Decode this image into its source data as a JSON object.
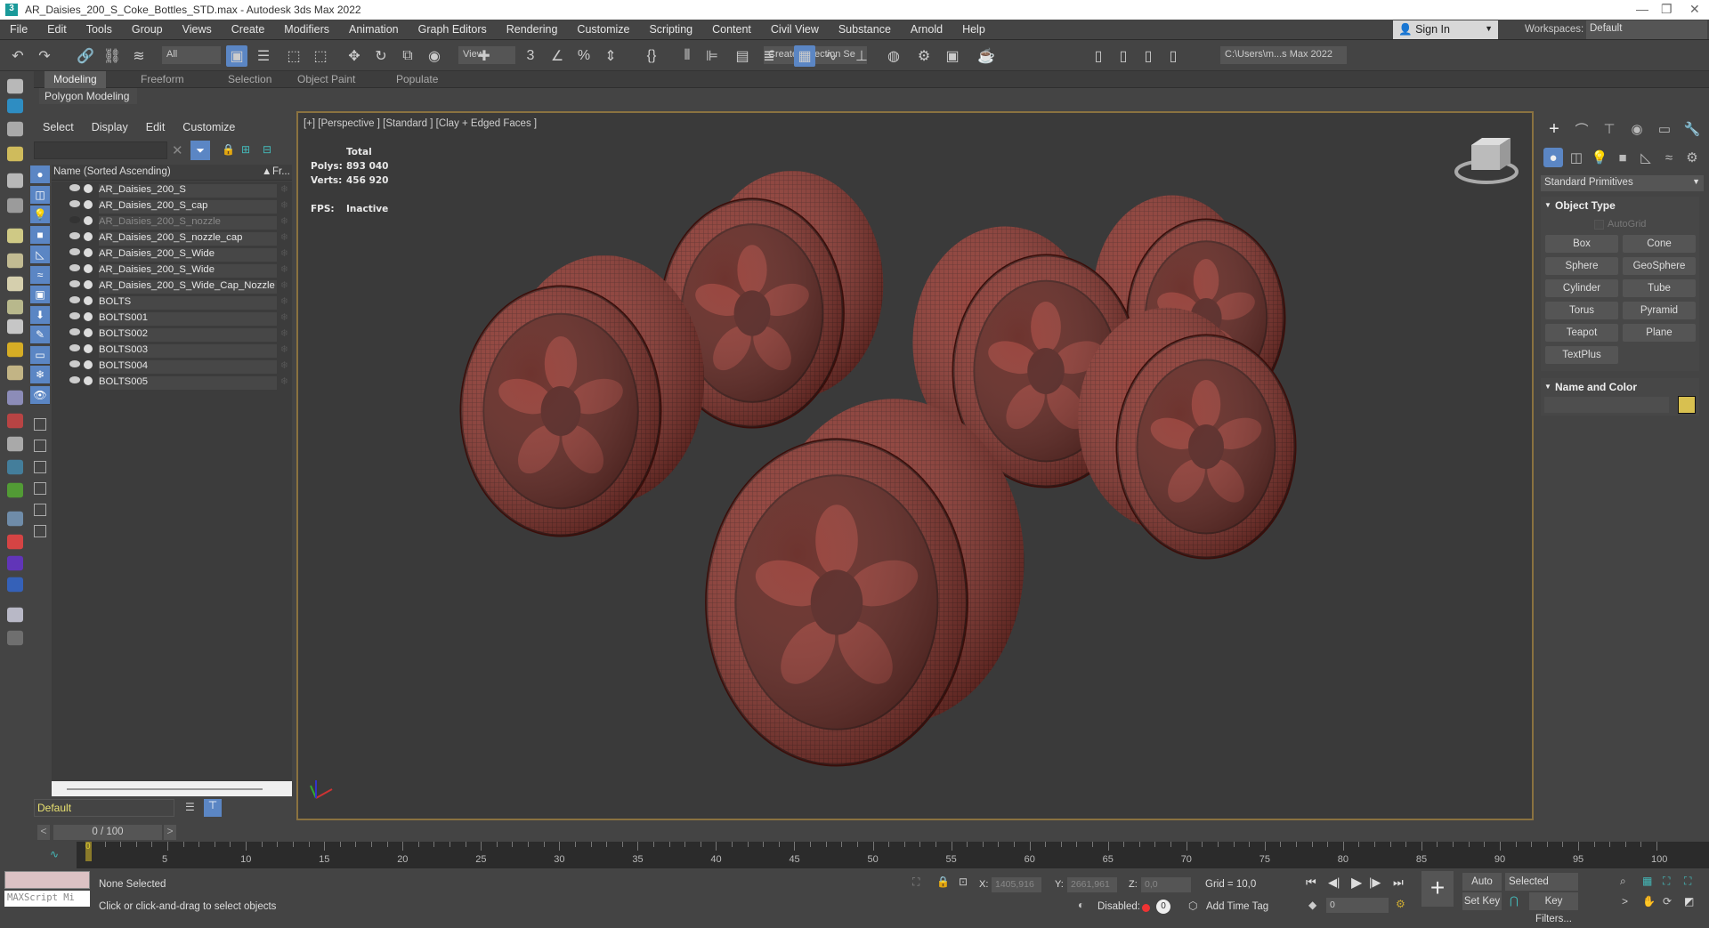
{
  "window": {
    "title": "AR_Daisies_200_S_Coke_Bottles_STD.max - Autodesk 3ds Max 2022",
    "app_icon": "3",
    "controls": [
      "—",
      "❐",
      "✕"
    ]
  },
  "menu": [
    "File",
    "Edit",
    "Tools",
    "Group",
    "Views",
    "Create",
    "Modifiers",
    "Animation",
    "Graph Editors",
    "Rendering",
    "Customize",
    "Scripting",
    "Content",
    "Civil View",
    "Substance",
    "Arnold",
    "Help"
  ],
  "account": {
    "sign_in": "Sign In",
    "workspaces_label": "Workspaces:",
    "workspace": "Default"
  },
  "toolbar": {
    "selection_filter": "All",
    "ref_coord": "View",
    "named_selection": "Create Selection Se",
    "project_path": "C:\\Users\\m...s Max 2022",
    "icons": [
      "undo-icon",
      "redo-icon",
      "link-icon",
      "unlink-icon",
      "bind-space-warp-icon",
      "select-object-icon",
      "select-by-name-icon",
      "rect-selection-icon",
      "window-crossing-icon",
      "move-icon",
      "rotate-icon",
      "scale-icon",
      "placement-icon",
      "pivot-icon",
      "snap-icon",
      "angle-snap-icon",
      "percent-snap-icon",
      "spinner-snap-icon",
      "edit-named-sets-icon",
      "mirror-icon",
      "align-icon",
      "scene-explorer-icon",
      "layer-explorer-icon",
      "ribbon-toggle-icon",
      "curve-editor-icon",
      "schematic-icon",
      "material-editor-icon",
      "render-setup-icon",
      "rendered-frame-icon",
      "render-icon",
      "project-icon",
      "open-project-icon",
      "new-project-icon",
      "project-folder-icon"
    ]
  },
  "ribbon": {
    "tabs": [
      "Modeling",
      "Freeform",
      "Selection",
      "Object Paint",
      "Populate"
    ],
    "active": "Modeling",
    "panel": "Polygon Modeling"
  },
  "scene_explorer": {
    "menu": [
      "Select",
      "Display",
      "Edit",
      "Customize"
    ],
    "search_value": "",
    "column_name": "Name (Sorted Ascending)",
    "column_frozen": "Fr...",
    "items": [
      {
        "name": "AR_Daisies_200_S",
        "hidden": false
      },
      {
        "name": "AR_Daisies_200_S_cap",
        "hidden": false
      },
      {
        "name": "AR_Daisies_200_S_nozzle",
        "hidden": true
      },
      {
        "name": "AR_Daisies_200_S_nozzle_cap",
        "hidden": false
      },
      {
        "name": "AR_Daisies_200_S_Wide",
        "hidden": false
      },
      {
        "name": "AR_Daisies_200_S_Wide",
        "hidden": false
      },
      {
        "name": "AR_Daisies_200_S_Wide_Cap_Nozzle",
        "hidden": false
      },
      {
        "name": "BOLTS",
        "hidden": false
      },
      {
        "name": "BOLTS001",
        "hidden": false
      },
      {
        "name": "BOLTS002",
        "hidden": false
      },
      {
        "name": "BOLTS003",
        "hidden": false
      },
      {
        "name": "BOLTS004",
        "hidden": false
      },
      {
        "name": "BOLTS005",
        "hidden": false
      }
    ],
    "layer": "Default"
  },
  "viewport": {
    "label": "[+] [Perspective ] [Standard ] [Clay + Edged Faces ]",
    "stats_header": "Total",
    "polys_label": "Polys:",
    "polys": "893 040",
    "verts_label": "Verts:",
    "verts": "456 920",
    "fps_label": "FPS:",
    "fps": "Inactive",
    "object_color": "#7a2620"
  },
  "command_panel": {
    "category": "Standard Primitives",
    "object_type": "Object Type",
    "autogrid": "AutoGrid",
    "buttons": [
      "Box",
      "Cone",
      "Sphere",
      "GeoSphere",
      "Cylinder",
      "Tube",
      "Torus",
      "Pyramid",
      "Teapot",
      "Plane",
      "TextPlus"
    ],
    "name_and_color": "Name and Color",
    "name_value": "",
    "swatch_color": "#d8c050"
  },
  "timeline": {
    "slider": "0 / 100",
    "start": 0,
    "end": 100,
    "label_step": 5
  },
  "status": {
    "maxscript": "MAXScript Mi",
    "selection": "None Selected",
    "prompt": "Click or click-and-drag to select objects",
    "x_label": "X:",
    "x": "1405,916",
    "y_label": "Y:",
    "y": "2661,961",
    "z_label": "Z:",
    "z": "0,0",
    "grid": "Grid = 10,0",
    "disabled": "Disabled:",
    "add_time_tag": "Add Time Tag",
    "auto_key": "Auto Key",
    "set_key": "Set Key",
    "key_mode": "Selected",
    "key_filters": "Key Filters...",
    "frame": "0"
  }
}
